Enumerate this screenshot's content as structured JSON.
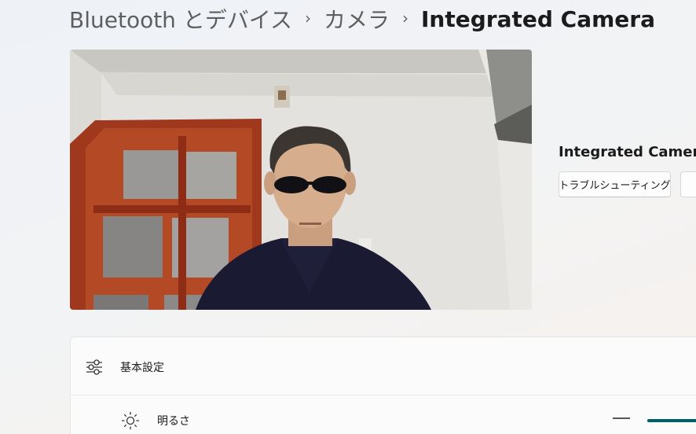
{
  "breadcrumb": {
    "parent1": "Bluetooth とデバイス",
    "parent2": "カメラ",
    "current": "Integrated Camera",
    "separator": "›"
  },
  "preview": {
    "description_icon": "camera-preview-image"
  },
  "device": {
    "name": "Integrated Camera",
    "troubleshoot_label": "トラブルシューティング"
  },
  "settings": {
    "header_label": "基本設定",
    "header_icon": "sliders-icon",
    "brightness": {
      "label": "明るさ",
      "icon": "sun-icon",
      "value_fraction": 1.0
    }
  },
  "colors": {
    "accent": "#005f6b"
  }
}
